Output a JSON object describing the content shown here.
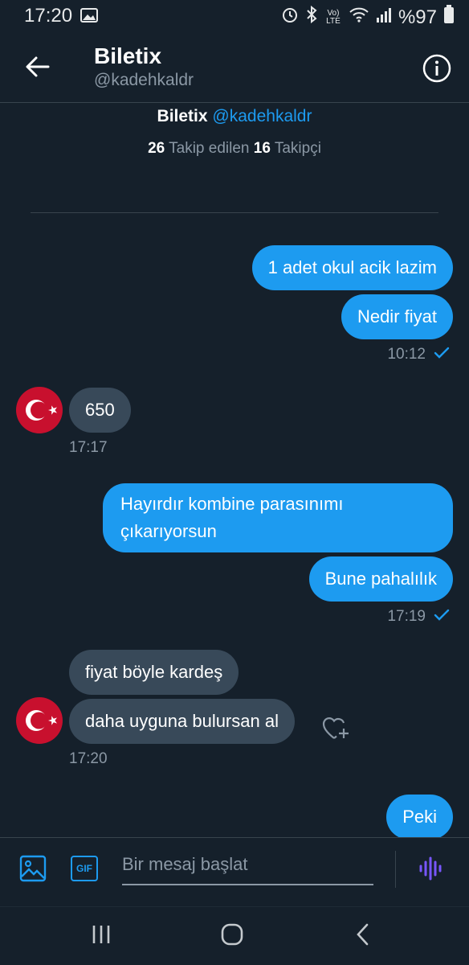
{
  "status": {
    "time": "17:20",
    "battery": "%97",
    "lte": "Vo) LTE"
  },
  "header": {
    "title": "Biletix",
    "handle": "@kadehkaldr"
  },
  "profile": {
    "name": "Biletix",
    "handle": "@kadehkaldr",
    "following_count": "26",
    "following_label": "Takip edilen",
    "followers_count": "16",
    "followers_label": "Takipçi"
  },
  "messages": [
    {
      "dir": "out",
      "text": "1 adet okul acik lazim"
    },
    {
      "dir": "out",
      "text": "Nedir fiyat",
      "time": "10:12"
    },
    {
      "dir": "in",
      "text": "650",
      "time": "17:17"
    },
    {
      "dir": "out",
      "text": "Hayırdır kombine parasınımı çıkarıyorsun"
    },
    {
      "dir": "out",
      "text": "Bune pahalılık",
      "time": "17:19"
    },
    {
      "dir": "in",
      "text": "fiyat böyle kardeş"
    },
    {
      "dir": "in",
      "text": "daha uyguna bulursan al",
      "time": "17:20"
    },
    {
      "dir": "out",
      "text": "Peki"
    }
  ],
  "composer": {
    "placeholder": "Bir mesaj başlat",
    "gif_label": "GIF"
  },
  "colors": {
    "background": "#15202b",
    "accent": "#1d9bf0",
    "incoming_bubble": "#384959",
    "muted_text": "#8b98a5",
    "voice_icon": "#7856ff"
  },
  "icons": [
    "gallery-icon",
    "alarm-icon",
    "bluetooth-icon",
    "wifi-icon",
    "signal-icon",
    "battery-icon",
    "back-arrow-icon",
    "info-icon",
    "image-icon",
    "gif-icon",
    "voice-icon",
    "heart-plus-icon",
    "check-icon",
    "recents-icon",
    "home-icon",
    "back-icon"
  ]
}
